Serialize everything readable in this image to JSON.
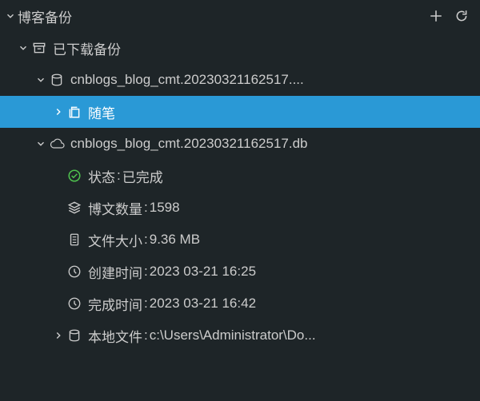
{
  "header": {
    "title": "博客备份"
  },
  "tree": {
    "downloaded_label": "已下载备份",
    "backup1": {
      "name": "cnblogs_blog_cmt.20230321162517....",
      "notes_label": "随笔"
    },
    "backup2": {
      "name": "cnblogs_blog_cmt.20230321162517.db",
      "status_label": "状态",
      "status_value": "已完成",
      "count_label": "博文数量",
      "count_value": "1598",
      "size_label": "文件大小",
      "size_value": "9.36 MB",
      "created_label": "创建时间",
      "created_value": "2023 03-21 16:25",
      "completed_label": "完成时间",
      "completed_value": "2023 03-21 16:42",
      "local_label": "本地文件",
      "local_value": "c:\\Users\\Administrator\\Do..."
    }
  }
}
